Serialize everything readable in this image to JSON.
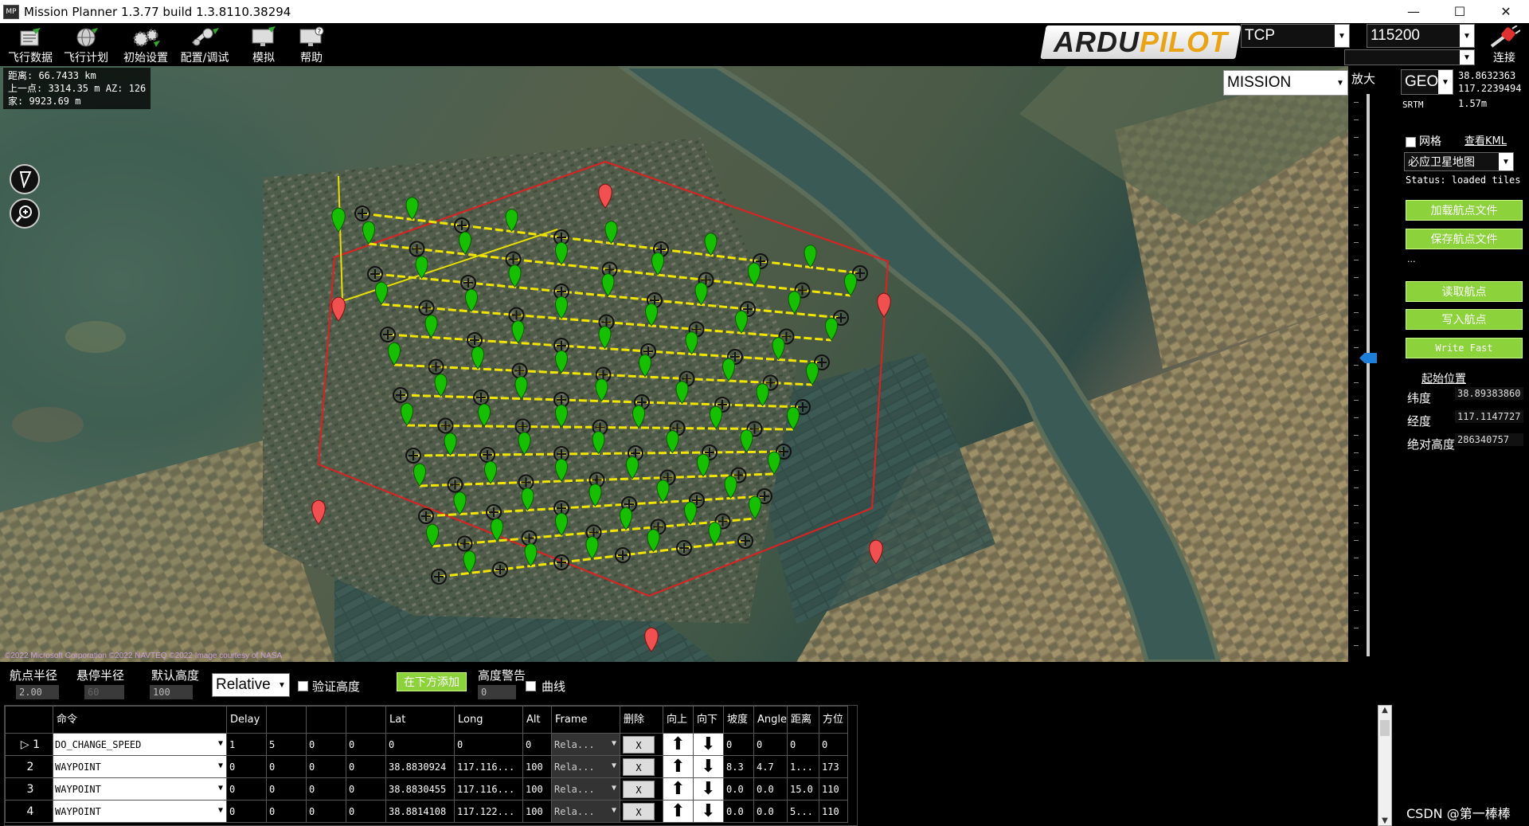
{
  "window": {
    "title": "Mission Planner 1.3.77 build 1.3.8110.38294",
    "app_icon": "MP",
    "minimize": "—",
    "maximize": "☐",
    "close": "✕"
  },
  "menu": [
    {
      "label": "飞行数据",
      "icon": "flight-data-icon"
    },
    {
      "label": "飞行计划",
      "icon": "globe-icon"
    },
    {
      "label": "初始设置",
      "icon": "gears-icon"
    },
    {
      "label": "配置/调试",
      "icon": "wrench-icon"
    },
    {
      "label": "模拟",
      "icon": "monitor-icon"
    },
    {
      "label": "帮助",
      "icon": "help-icon"
    }
  ],
  "logo": {
    "part1": "ARDU",
    "part2": "PILOT"
  },
  "connection": {
    "port": "TCP",
    "baud": "115200",
    "connect_label": "连接"
  },
  "map_info": {
    "line1": "距离: 66.7433 km",
    "line2": "上一点: 3314.35 m AZ: 126",
    "line3": "家: 9923.69 m"
  },
  "copyright": "©2022 Microsoft Corporation ©2022 NAVTEQ ©2022 Image courtesy of NASA",
  "mode": "MISSION",
  "zoom_label": "放大",
  "right_panel": {
    "coord_system": "GEO",
    "coord_lat": "38.8632363",
    "coord_lng": "117.2239494",
    "alt_source": "SRTM",
    "alt_value": "1.57m",
    "grid_label": "网格",
    "view_kml": "查看KML",
    "map_type": "必应卫星地图",
    "status": "Status: loaded tiles",
    "load_wp": "加载航点文件",
    "save_wp": "保存航点文件",
    "ellipsis": "...",
    "read_wp": "读取航点",
    "write_wp": "写入航点",
    "write_fast": "Write Fast",
    "home_title": "起始位置",
    "home_lat_label": "纬度",
    "home_lat": "38.89383860",
    "home_lng_label": "经度",
    "home_lng": "117.1147727",
    "home_alt_label": "绝对高度",
    "home_alt": "286340757",
    "collapse": "V"
  },
  "options": {
    "wp_radius_label": "航点半径",
    "wp_radius": "2.00",
    "loiter_radius_label": "悬停半径",
    "loiter_radius": "60",
    "default_alt_label": "默认高度",
    "default_alt": "100",
    "alt_frame": "Relative",
    "verify_height": "验证高度",
    "add_below": "在下方添加",
    "alt_warn_label": "高度警告",
    "alt_warn": "0",
    "spline": "曲线"
  },
  "table": {
    "headers": [
      "",
      "命令",
      "Delay",
      "",
      "",
      "",
      "Lat",
      "Long",
      "Alt",
      "Frame",
      "删除",
      "向上",
      "向下",
      "坡度",
      "Angle",
      "距离",
      "方位"
    ],
    "rows": [
      {
        "n": "1",
        "cmd": "DO_CHANGE_SPEED",
        "p1": "1",
        "p2": "5",
        "p3": "0",
        "p4": "0",
        "lat": "0",
        "lng": "0",
        "alt": "0",
        "frame": "Rela...",
        "del": "X",
        "grad": "0",
        "angle": "0",
        "dist": "0",
        "az": "0"
      },
      {
        "n": "2",
        "cmd": "WAYPOINT",
        "p1": "0",
        "p2": "0",
        "p3": "0",
        "p4": "0",
        "lat": "38.8830924",
        "lng": "117.116...",
        "alt": "100",
        "frame": "Rela...",
        "del": "X",
        "grad": "8.3",
        "angle": "4.7",
        "dist": "1...",
        "az": "173"
      },
      {
        "n": "3",
        "cmd": "WAYPOINT",
        "p1": "0",
        "p2": "0",
        "p3": "0",
        "p4": "0",
        "lat": "38.8830455",
        "lng": "117.116...",
        "alt": "100",
        "frame": "Rela...",
        "del": "X",
        "grad": "0.0",
        "angle": "0.0",
        "dist": "15.0",
        "az": "110"
      },
      {
        "n": "4",
        "cmd": "WAYPOINT",
        "p1": "0",
        "p2": "0",
        "p3": "0",
        "p4": "0",
        "lat": "38.8814108",
        "lng": "117.122...",
        "alt": "100",
        "frame": "Rela...",
        "del": "X",
        "grad": "0.0",
        "angle": "0.0",
        "dist": "5...",
        "az": "110"
      }
    ]
  },
  "watermark": "CSDN @第一棒棒"
}
